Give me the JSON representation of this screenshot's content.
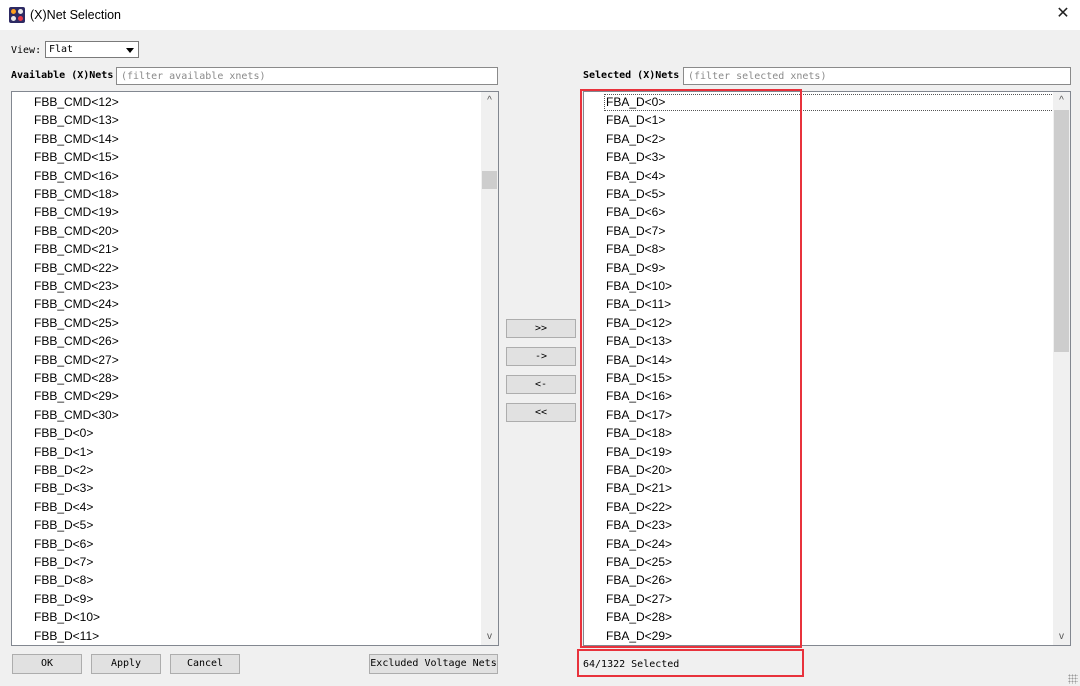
{
  "window": {
    "title": "(X)Net Selection",
    "close_glyph": "✕"
  },
  "view": {
    "label": "View:",
    "value": "Flat"
  },
  "available": {
    "label": "Available (X)Nets",
    "filter_placeholder": "(filter available xnets)",
    "items": [
      "FBB_CMD<12>",
      "FBB_CMD<13>",
      "FBB_CMD<14>",
      "FBB_CMD<15>",
      "FBB_CMD<16>",
      "FBB_CMD<18>",
      "FBB_CMD<19>",
      "FBB_CMD<20>",
      "FBB_CMD<21>",
      "FBB_CMD<22>",
      "FBB_CMD<23>",
      "FBB_CMD<24>",
      "FBB_CMD<25>",
      "FBB_CMD<26>",
      "FBB_CMD<27>",
      "FBB_CMD<28>",
      "FBB_CMD<29>",
      "FBB_CMD<30>",
      "FBB_D<0>",
      "FBB_D<1>",
      "FBB_D<2>",
      "FBB_D<3>",
      "FBB_D<4>",
      "FBB_D<5>",
      "FBB_D<6>",
      "FBB_D<7>",
      "FBB_D<8>",
      "FBB_D<9>",
      "FBB_D<10>",
      "FBB_D<11>"
    ]
  },
  "selected": {
    "label": "Selected (X)Nets",
    "filter_placeholder": "(filter selected xnets)",
    "items": [
      "FBA_D<0>",
      "FBA_D<1>",
      "FBA_D<2>",
      "FBA_D<3>",
      "FBA_D<4>",
      "FBA_D<5>",
      "FBA_D<6>",
      "FBA_D<7>",
      "FBA_D<8>",
      "FBA_D<9>",
      "FBA_D<10>",
      "FBA_D<11>",
      "FBA_D<12>",
      "FBA_D<13>",
      "FBA_D<14>",
      "FBA_D<15>",
      "FBA_D<16>",
      "FBA_D<17>",
      "FBA_D<18>",
      "FBA_D<19>",
      "FBA_D<20>",
      "FBA_D<21>",
      "FBA_D<22>",
      "FBA_D<23>",
      "FBA_D<24>",
      "FBA_D<25>",
      "FBA_D<26>",
      "FBA_D<27>",
      "FBA_D<28>",
      "FBA_D<29>"
    ],
    "status": "64/1322 Selected"
  },
  "transfer": {
    "add_all": ">>",
    "add": "->",
    "remove": "<-",
    "remove_all": "<<"
  },
  "buttons": {
    "ok": "OK",
    "apply": "Apply",
    "cancel": "Cancel",
    "excluded": "Excluded Voltage Nets"
  },
  "icons": {
    "scroll_up": "^",
    "scroll_down": "v"
  },
  "colors": {
    "highlight": "#e8323c",
    "app_icon": "#2d2a63"
  }
}
